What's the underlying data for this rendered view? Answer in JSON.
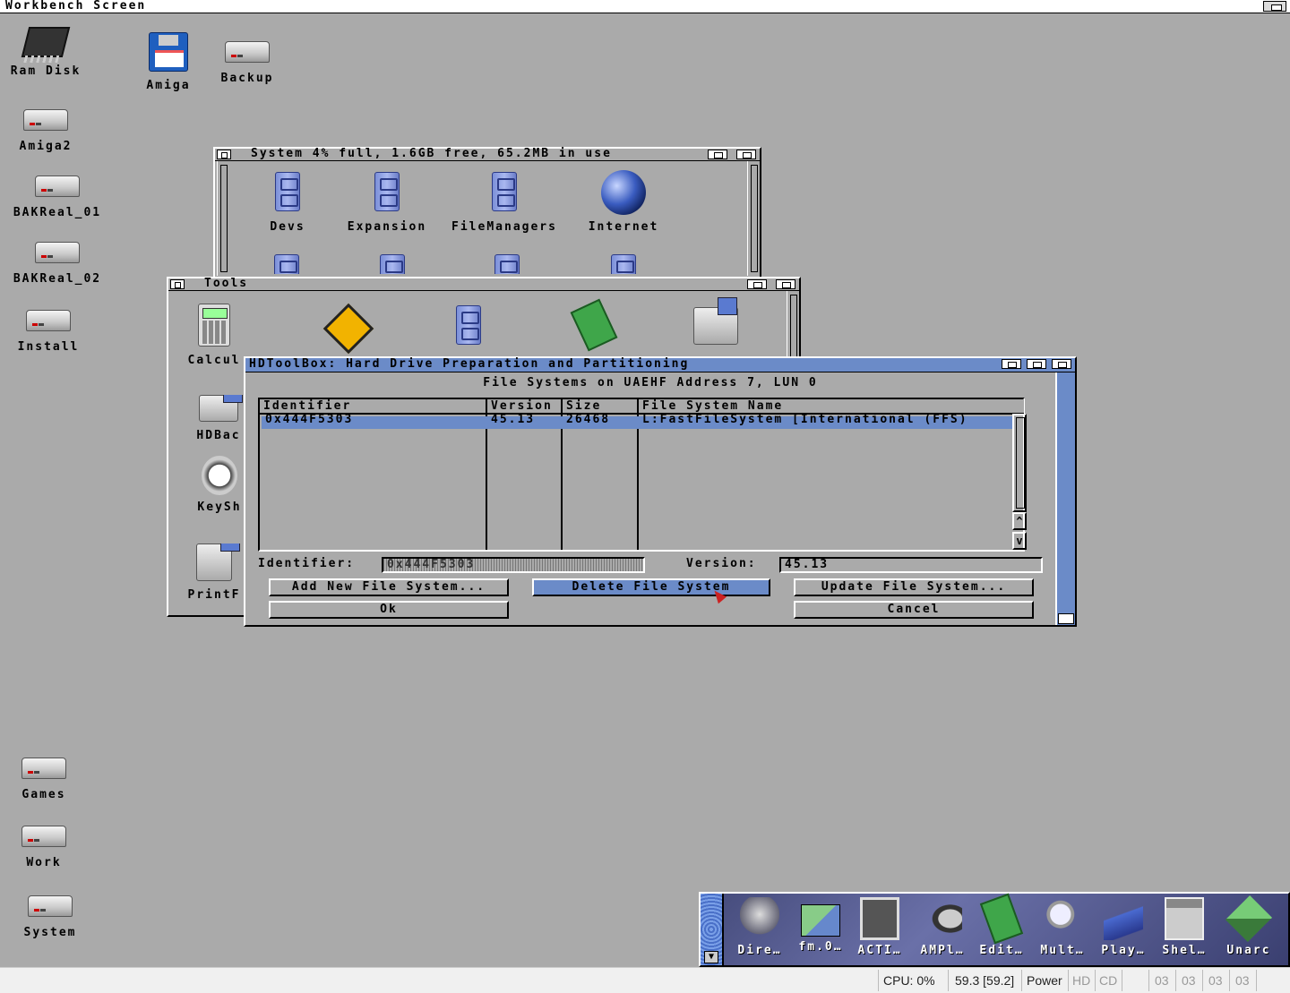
{
  "screen": {
    "title": "Workbench Screen"
  },
  "desktop_icons": [
    {
      "label": "Ram Disk"
    },
    {
      "label": "Amiga"
    },
    {
      "label": "Backup"
    },
    {
      "label": "Amiga2"
    },
    {
      "label": "BAKReal_01"
    },
    {
      "label": "BAKReal_02"
    },
    {
      "label": "Install"
    },
    {
      "label": "Games"
    },
    {
      "label": "Work"
    },
    {
      "label": "System"
    }
  ],
  "system_window": {
    "title": "System  4% full, 1.6GB free, 65.2MB in use",
    "icons": [
      "Devs",
      "Expansion",
      "FileManagers",
      "Internet"
    ]
  },
  "tools_window": {
    "title": "Tools",
    "icons": [
      "Calcul",
      "HDBac",
      "KeySh",
      "PrintF"
    ]
  },
  "hdtoolbox": {
    "title": "HDToolBox: Hard Drive Preparation and Partitioning",
    "heading": "File Systems on UAEHF Address 7, LUN 0",
    "columns": [
      "Identifier",
      "Version",
      "Size",
      "File System Name"
    ],
    "rows": [
      {
        "identifier": "0x444F5303",
        "version": "45.13",
        "size": "26468",
        "name": "L:FastFileSystem [International (FFS)"
      }
    ],
    "identifier_label": "Identifier:",
    "identifier_value": "0x444F5303",
    "version_label": "Version:",
    "version_value": "45.13",
    "buttons": {
      "add": "Add New File System...",
      "delete": "Delete File System",
      "update": "Update File System...",
      "ok": "Ok",
      "cancel": "Cancel"
    },
    "scroll_up": "^",
    "scroll_down": "v"
  },
  "dock": {
    "items": [
      "Dire…",
      "fm.0…",
      "ACTI…",
      "AMPl…",
      "Edit…",
      "Mult…",
      "Play…",
      "Shel…",
      "Unarc"
    ]
  },
  "statusbar": {
    "cpu": "CPU: 0%",
    "fps": "59.3 [59.2]",
    "power": "Power",
    "hd": "HD",
    "cd": "CD",
    "drives": [
      "03",
      "03",
      "03",
      "03"
    ]
  },
  "colors": {
    "workbench_gray": "#aaaaaa",
    "amiga_blue": "#6b8bc8"
  }
}
